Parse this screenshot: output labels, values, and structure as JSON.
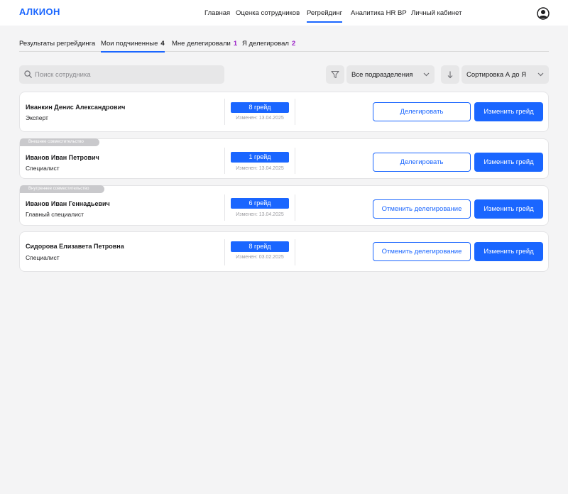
{
  "app": {
    "logo": "АЛКИОН"
  },
  "nav": {
    "items": [
      {
        "label": "Главная"
      },
      {
        "label": "Оценка сотрудников"
      },
      {
        "label": "Регрейдинг"
      },
      {
        "label": "Аналитика HR BP"
      },
      {
        "label": "Личный кабинет"
      }
    ],
    "active": "Регрейдинг"
  },
  "tabs": [
    {
      "label": "Результаты регрейдинга",
      "count": ""
    },
    {
      "label": "Мои подчиненные",
      "count": "4"
    },
    {
      "label": "Мне делегировали",
      "count": "1"
    },
    {
      "label": "Я делегировал",
      "count": "2"
    }
  ],
  "search": {
    "placeholder": "Поиск сотрудника",
    "value": ""
  },
  "filters": {
    "department": "Все подразделения",
    "sort": "Сортировка А до Я"
  },
  "employees": [
    {
      "badge": "",
      "name": "Иванкин Денис Александрович",
      "position": "Эксперт",
      "grade": "8 грейд",
      "changed": "Изменен: 13.04.2025",
      "primary_action": "Делегировать",
      "secondary_action": "Изменить грейд"
    },
    {
      "badge": "Внешнее совместительство",
      "name": "Иванов Иван Петрович",
      "position": "Специалист",
      "grade": "1 грейд",
      "changed": "Изменен: 13.04.2025",
      "primary_action": "Делегировать",
      "secondary_action": "Изменить грейд"
    },
    {
      "badge": "Внутреннее совместительство",
      "name": "Иванов Иван Геннадьевич",
      "position": "Главный специалист",
      "grade": "6 грейд",
      "changed": "Изменен: 13.04.2025",
      "primary_action": "Отменить делегирование",
      "secondary_action": "Изменить грейд"
    },
    {
      "badge": "",
      "name": "Сидорова Елизавета Петровна",
      "position": "Специалист",
      "grade": "8 грейд",
      "changed": "Изменен: 03.02.2025",
      "primary_action": "Отменить делегирование",
      "secondary_action": "Изменить грейд"
    }
  ],
  "colors": {
    "accent": "#1a66ff",
    "count_highlight": "#9b22c8",
    "badge": "#c9c9cc",
    "background": "#f4f4f5"
  }
}
